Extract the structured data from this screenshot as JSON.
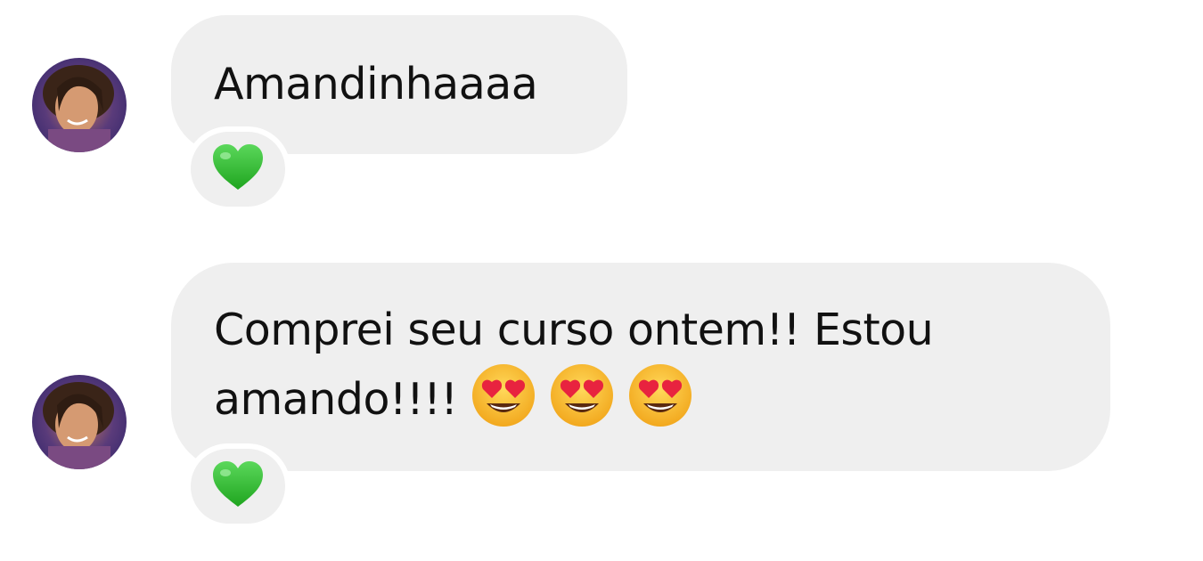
{
  "messages": [
    {
      "text": "Amandinhaaaa",
      "emojis": [],
      "reaction": "green-heart-icon"
    },
    {
      "line1": "Comprei seu curso ontem!! Estou",
      "line2": "amando!!!!",
      "emojis": [
        "heart-eyes-face-icon",
        "heart-eyes-face-icon",
        "heart-eyes-face-icon"
      ],
      "reaction": "green-heart-icon"
    }
  ],
  "colors": {
    "bubble": "#efefef",
    "text": "#111111",
    "background": "#ffffff",
    "reaction_heart": "#3fc43f"
  }
}
